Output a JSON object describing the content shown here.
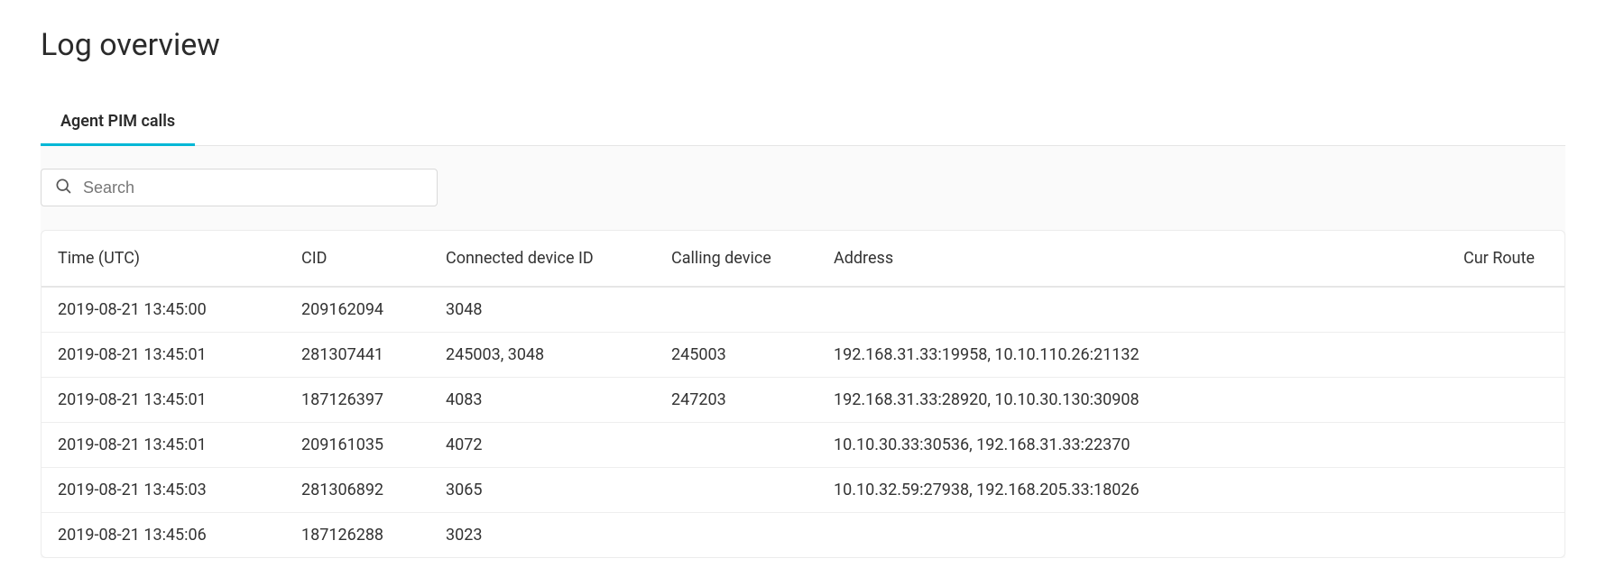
{
  "header": {
    "title": "Log overview"
  },
  "tabs": {
    "active_label": "Agent PIM calls"
  },
  "search": {
    "placeholder": "Search"
  },
  "table": {
    "columns": {
      "time": "Time (UTC)",
      "cid": "CID",
      "connected": "Connected device ID",
      "calling": "Calling device",
      "address": "Address",
      "route": "Cur Route"
    },
    "rows": [
      {
        "time": "2019-08-21 13:45:00",
        "cid": "209162094",
        "connected": "3048",
        "calling": "",
        "address": "",
        "route": ""
      },
      {
        "time": "2019-08-21 13:45:01",
        "cid": "281307441",
        "connected": "245003, 3048",
        "calling": "245003",
        "address": "192.168.31.33:19958, 10.10.110.26:21132",
        "route": ""
      },
      {
        "time": "2019-08-21 13:45:01",
        "cid": "187126397",
        "connected": "4083",
        "calling": "247203",
        "address": "192.168.31.33:28920, 10.10.30.130:30908",
        "route": ""
      },
      {
        "time": "2019-08-21 13:45:01",
        "cid": "209161035",
        "connected": "4072",
        "calling": "",
        "address": "10.10.30.33:30536, 192.168.31.33:22370",
        "route": ""
      },
      {
        "time": "2019-08-21 13:45:03",
        "cid": "281306892",
        "connected": "3065",
        "calling": "",
        "address": "10.10.32.59:27938, 192.168.205.33:18026",
        "route": ""
      },
      {
        "time": "2019-08-21 13:45:06",
        "cid": "187126288",
        "connected": "3023",
        "calling": "",
        "address": "",
        "route": ""
      }
    ]
  }
}
